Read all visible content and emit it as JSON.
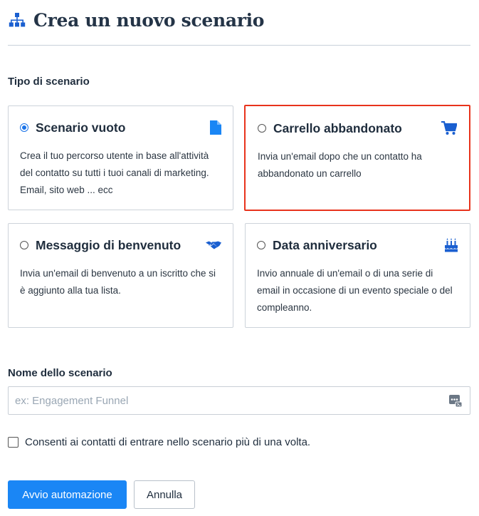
{
  "header": {
    "title": "Crea un nuovo scenario",
    "icon": "sitemap-icon"
  },
  "scenario_type": {
    "label": "Tipo di scenario",
    "options": [
      {
        "title": "Scenario vuoto",
        "description": "Crea il tuo percorso utente in base all'attività del contatto su tutti i tuoi canali di marketing. Email, sito web ... ecc",
        "selected": true,
        "icon": "document-icon"
      },
      {
        "title": "Carrello abbandonato",
        "description": "Invia un'email dopo che un contatto ha abbandonato un carrello",
        "selected": false,
        "icon": "shopping-cart-icon"
      },
      {
        "title": "Messaggio di benvenuto",
        "description": "Invia un'email di benvenuto a un iscritto che si è aggiunto alla tua lista.",
        "selected": false,
        "icon": "handshake-icon"
      },
      {
        "title": "Data anniversario",
        "description": "Invio annuale di un'email o di una serie di email in occasione di un evento speciale o del compleanno.",
        "selected": false,
        "icon": "birthday-cake-icon"
      }
    ]
  },
  "scenario_name": {
    "label": "Nome dello scenario",
    "placeholder": "ex: Engagement Funnel",
    "value": ""
  },
  "allow_multiple": {
    "label": "Consenti ai contatti di entrare nello scenario più di una volta.",
    "checked": false
  },
  "actions": {
    "primary": "Avvio automazione",
    "cancel": "Annulla"
  },
  "colors": {
    "accent": "#1a86f5",
    "highlight": "#e8331c",
    "text": "#1f2d3d"
  }
}
